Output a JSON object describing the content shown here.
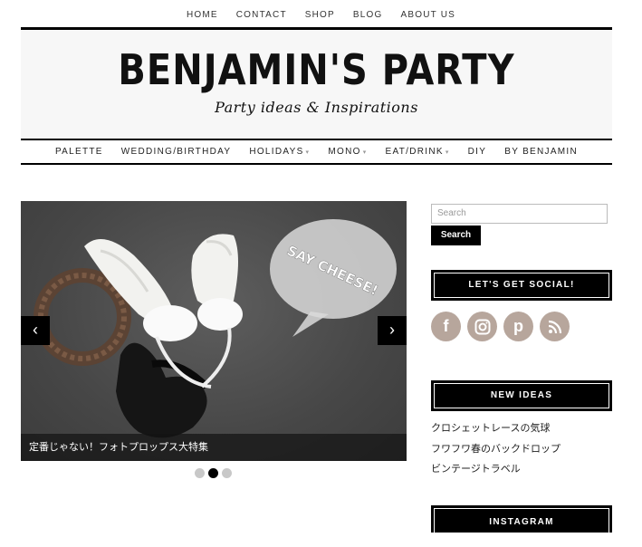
{
  "top_nav": [
    "HOME",
    "CONTACT",
    "SHOP",
    "BLOG",
    "ABOUT US"
  ],
  "header": {
    "title": "BENJAMIN'S PARTY",
    "tagline": "Party ideas & Inspirations"
  },
  "main_nav": [
    {
      "label": "PALETTE",
      "dropdown": false
    },
    {
      "label": "WEDDING/BIRTHDAY",
      "dropdown": false
    },
    {
      "label": "HOLIDAYS",
      "dropdown": true
    },
    {
      "label": "MONO",
      "dropdown": true
    },
    {
      "label": "EAT/DRINK",
      "dropdown": true
    },
    {
      "label": "DIY",
      "dropdown": false
    },
    {
      "label": "BY BENJAMIN",
      "dropdown": false
    }
  ],
  "slider": {
    "caption": "定番じゃない！フォトプロップス大特集",
    "bubble_text": "SAY CHEESE!",
    "prev_icon": "‹",
    "next_icon": "›",
    "slide_count": 3,
    "active_slide": 2
  },
  "sidebar": {
    "search_placeholder": "Search",
    "search_button": "Search",
    "social_title": "LET'S GET SOCIAL!",
    "social_icons": [
      "facebook-icon",
      "instagram-icon",
      "pinterest-icon",
      "rss-icon"
    ],
    "ideas_title": "NEW IDEAS",
    "ideas": [
      "クロシェットレースの気球",
      "フワフワ春のバックドロップ",
      "ビンテージトラベル"
    ],
    "instagram_title": "INSTAGRAM"
  },
  "colors": {
    "social_icon_bg": "#b7a69c",
    "accent": "#000000"
  }
}
